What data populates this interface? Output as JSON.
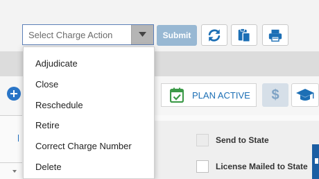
{
  "toolbar": {
    "charge_action_placeholder": "Select Charge Action",
    "submit_label": "Submit",
    "icons": [
      "refresh-icon",
      "paste-icon",
      "print-icon"
    ]
  },
  "charge_action_menu": {
    "items": [
      "Adjudicate",
      "Close",
      "Reschedule",
      "Retire",
      "Correct Charge Number",
      "Delete"
    ]
  },
  "plan": {
    "label": "PLAN ACTIVE",
    "icon": "calendar-check-icon"
  },
  "checkboxes": {
    "send_to_state": "Send to State",
    "license_mailed": "License Mailed to State"
  },
  "colors": {
    "accent": "#1c6fb5",
    "submit_disabled": "#98b8d3",
    "calendar_green": "#3c9a48"
  }
}
